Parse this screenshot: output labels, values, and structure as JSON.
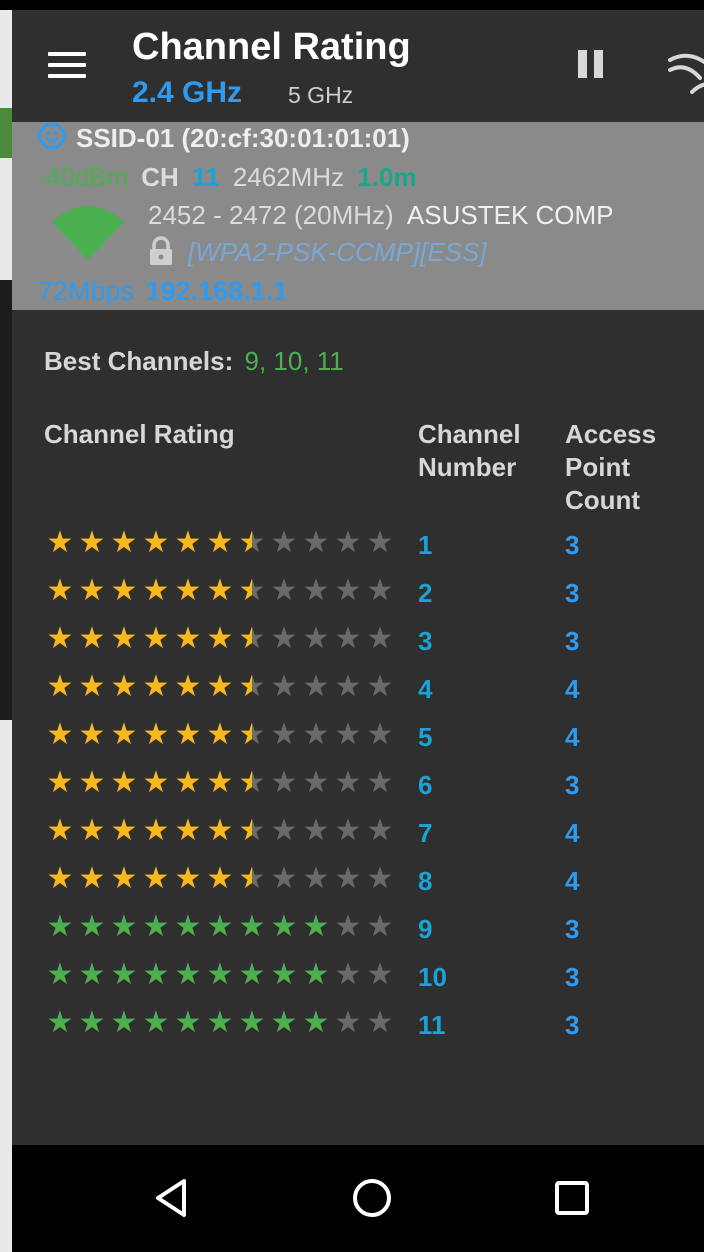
{
  "header": {
    "title": "Channel Rating",
    "tabs": [
      {
        "label": "2.4 GHz",
        "selected": true
      },
      {
        "label": "5 GHz",
        "selected": false
      }
    ]
  },
  "access_point": {
    "ssid": "SSID-01 (20:cf:30:01:01:01)",
    "signal": "-40dBm",
    "channel_label": "CH",
    "channel": "11",
    "frequency": "2462MHz",
    "distance": "1.0m",
    "range": "2452 - 2472 (20MHz)",
    "vendor": "ASUSTEK COMP",
    "security": "[WPA2-PSK-CCMP][ESS]",
    "speed": "72Mbps",
    "ip": "192.168.1.1",
    "signal_icon": "wifi-icon",
    "status_icon": "smile-icon"
  },
  "best_channels": {
    "label": "Best Channels:",
    "value": "9, 10, 11"
  },
  "table_headers": {
    "rating": "Channel Rating",
    "channel_number": [
      "Channel",
      "Number"
    ],
    "ap_count": [
      "Access",
      "Point",
      "Count"
    ]
  },
  "max_stars": 11,
  "rows": [
    {
      "channel": "1",
      "count": "3",
      "rating": 6.5
    },
    {
      "channel": "2",
      "count": "3",
      "rating": 6.5
    },
    {
      "channel": "3",
      "count": "3",
      "rating": 6.5
    },
    {
      "channel": "4",
      "count": "4",
      "rating": 6.5
    },
    {
      "channel": "5",
      "count": "4",
      "rating": 6.5
    },
    {
      "channel": "6",
      "count": "3",
      "rating": 6.5
    },
    {
      "channel": "7",
      "count": "4",
      "rating": 6.5
    },
    {
      "channel": "8",
      "count": "4",
      "rating": 6.5
    },
    {
      "channel": "9",
      "count": "3",
      "rating": 9
    },
    {
      "channel": "10",
      "count": "3",
      "rating": 9
    },
    {
      "channel": "11",
      "count": "3",
      "rating": 9
    }
  ],
  "colors": {
    "accent_blue": "#2e9bf0",
    "star_gold": "#f8b91c",
    "star_green": "#4caf50",
    "star_empty": "#6a6a6a",
    "signal_green": "#4caf50"
  },
  "navbar": {
    "back_icon": "back-icon",
    "home_icon": "home-icon",
    "recents_icon": "recents-icon"
  }
}
